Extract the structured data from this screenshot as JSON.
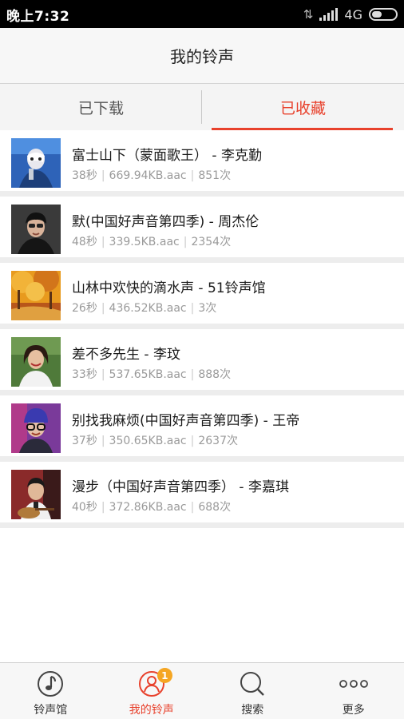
{
  "status_bar": {
    "time": "晚上7:32",
    "network": "4G"
  },
  "header": {
    "title": "我的铃声"
  },
  "tabs": [
    {
      "label": "已下载",
      "active": false
    },
    {
      "label": "已收藏",
      "active": true
    }
  ],
  "ringtones": [
    {
      "title": "富士山下（蒙面歌王） - 李克勤",
      "duration": "38秒",
      "size": "669.94KB.aac",
      "count": "851次"
    },
    {
      "title": "默(中国好声音第四季) - 周杰伦",
      "duration": "48秒",
      "size": "339.5KB.aac",
      "count": "2354次"
    },
    {
      "title": "山林中欢快的滴水声 - 51铃声馆",
      "duration": "26秒",
      "size": "436.52KB.aac",
      "count": "3次"
    },
    {
      "title": "差不多先生 - 李玟",
      "duration": "33秒",
      "size": "537.65KB.aac",
      "count": "888次"
    },
    {
      "title": "别找我麻烦(中国好声音第四季) - 王帝",
      "duration": "37秒",
      "size": "350.65KB.aac",
      "count": "2637次"
    },
    {
      "title": "漫步（中国好声音第四季） - 李嘉琪",
      "duration": "40秒",
      "size": "372.86KB.aac",
      "count": "688次"
    }
  ],
  "bottom_nav": [
    {
      "label": "铃声馆",
      "icon": "music-note-icon"
    },
    {
      "label": "我的铃声",
      "icon": "user-icon",
      "badge": "1",
      "active": true
    },
    {
      "label": "搜索",
      "icon": "search-icon"
    },
    {
      "label": "更多",
      "icon": "more-dots-icon"
    }
  ],
  "colors": {
    "accent": "#e8412c",
    "badge": "#f5a623"
  }
}
